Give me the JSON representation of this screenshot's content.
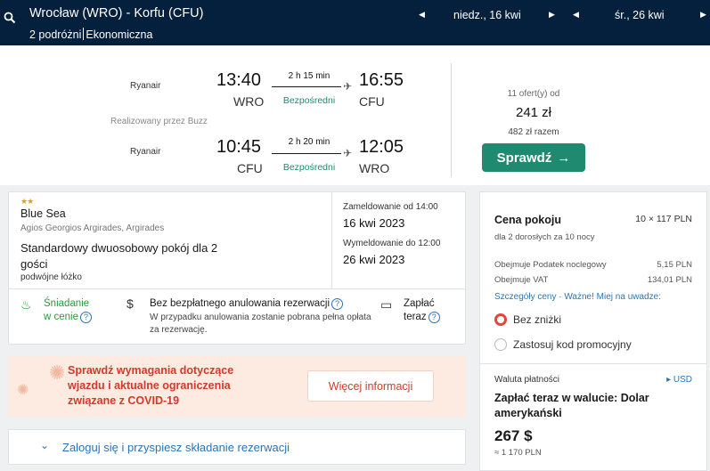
{
  "header": {
    "route": "Wrocław (WRO) - Korfu (CFU)",
    "travellers": "2 podróżni",
    "cabin": "Ekonomiczna",
    "depart_date": "niedz., 16 kwi",
    "return_date": "śr., 26 kwi"
  },
  "flights": {
    "outbound": {
      "airline": "Ryanair",
      "dep_time": "13:40",
      "dep_code": "WRO",
      "duration": "2 h 15 min",
      "stops": "Bezpośredni",
      "arr_time": "16:55",
      "arr_code": "CFU"
    },
    "operated_by": "Realizowany przez Buzz",
    "inbound": {
      "airline": "Ryanair",
      "dep_time": "10:45",
      "dep_code": "CFU",
      "duration": "2 h 20 min",
      "stops": "Bezpośredni",
      "arr_time": "12:05",
      "arr_code": "WRO"
    },
    "offers": "11 ofert(y) od",
    "price": "241 zł",
    "price_total": "482 zł razem",
    "check_label": "Sprawdź"
  },
  "hotel": {
    "stars": "★★",
    "name": "Blue Sea",
    "address": "Agios Georgios Argirades, Argirades",
    "room": "Standardowy dwuosobowy pokój dla 2 gości",
    "bed": "podwójne łóżko",
    "checkin_label": "Zameldowanie od 14:00",
    "checkin_date": "16 kwi 2023",
    "checkout_label": "Wymeldowanie do 12:00",
    "checkout_date": "26 kwi 2023",
    "breakfast": "Śniadanie",
    "breakfast2": "w cenie",
    "cancel_title": "Bez bezpłatnego anulowania rezerwacji",
    "cancel_sub": "W przypadku anulowania zostanie pobrana pełna opłata za rezerwację.",
    "pay_now": "Zapłać",
    "pay_now2": "teraz"
  },
  "covid": {
    "line1": "Sprawdź wymagania dotyczące",
    "line2": "wjazdu i aktualne ograniczenia",
    "line3": "związane z COVID-19",
    "button": "Więcej informacji"
  },
  "login": {
    "text": "Zaloguj się i przyspiesz składanie rezerwacji"
  },
  "price_panel": {
    "title": "Cena pokoju",
    "calc": "10 × 117 PLN",
    "sub": "dla 2 dorosłych  za 10 nocy",
    "tax1_label": "Obejmuje Podatek noclegowy",
    "tax1_value": "5,15 PLN",
    "tax2_label": "Obejmuje VAT",
    "tax2_value": "134,01 PLN",
    "links": "Szczegóły ceny · Ważne! Miej na uwadze:",
    "option1": "Bez zniżki",
    "option2": "Zastosuj kod promocyjny",
    "currency_label": "Waluta płatności",
    "currency": "USD",
    "pay_text": "Zapłać teraz w walucie: Dolar amerykański",
    "amount": "267 $",
    "amount_pln": "≈ 1 170 PLN"
  }
}
